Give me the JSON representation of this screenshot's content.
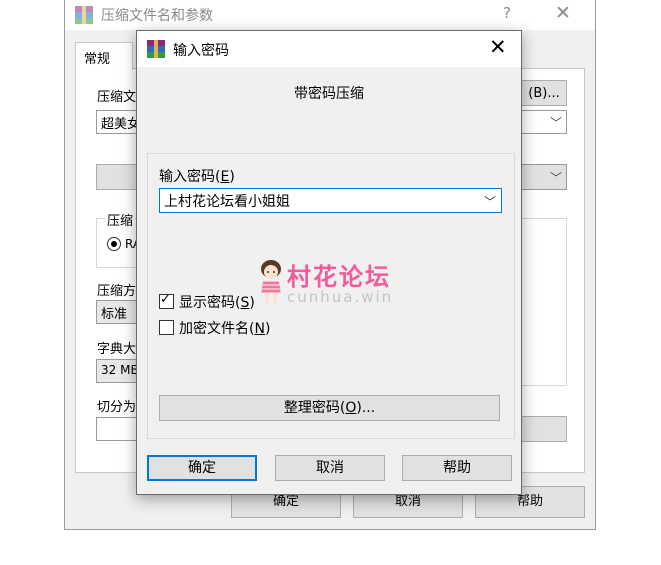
{
  "background_dialog": {
    "title": "压缩文件名和参数",
    "help_glyph": "?",
    "close_glyph": "✕",
    "tab_general": "常规",
    "archive_name_label": "压缩文",
    "archive_name_value": "超美女",
    "browse_button": "(B)...",
    "compress_group_label": "压缩",
    "format_radio": "RA",
    "method_label": "压缩方",
    "method_value": "标准",
    "dict_label": "字典大",
    "dict_value": "32 MB",
    "split_label": "切分为",
    "right_fragment": ")",
    "ok_button": "确定",
    "cancel_button": "取消",
    "help_button": "帮助"
  },
  "password_dialog": {
    "title": "输入密码",
    "close_glyph": "✕",
    "subtitle": "带密码压缩",
    "password_label_prefix": "输入密码(",
    "password_label_key": "E",
    "password_label_suffix": ")",
    "password_value": "上村花论坛看小姐姐",
    "show_password_prefix": "显示密码(",
    "show_password_key": "S",
    "show_password_suffix": ")",
    "show_password_checked": true,
    "encrypt_names_prefix": "加密文件名(",
    "encrypt_names_key": "N",
    "encrypt_names_suffix": ")",
    "encrypt_names_checked": false,
    "organize_prefix": "整理密码(",
    "organize_key": "O",
    "organize_suffix": ")...",
    "ok_button": "确定",
    "cancel_button": "取消",
    "help_button": "帮助"
  },
  "watermark": {
    "title": "村花论坛",
    "url": "cunhua.win"
  },
  "colors": {
    "accent": "#0078d7",
    "watermark_pink": "#f25a9a"
  }
}
